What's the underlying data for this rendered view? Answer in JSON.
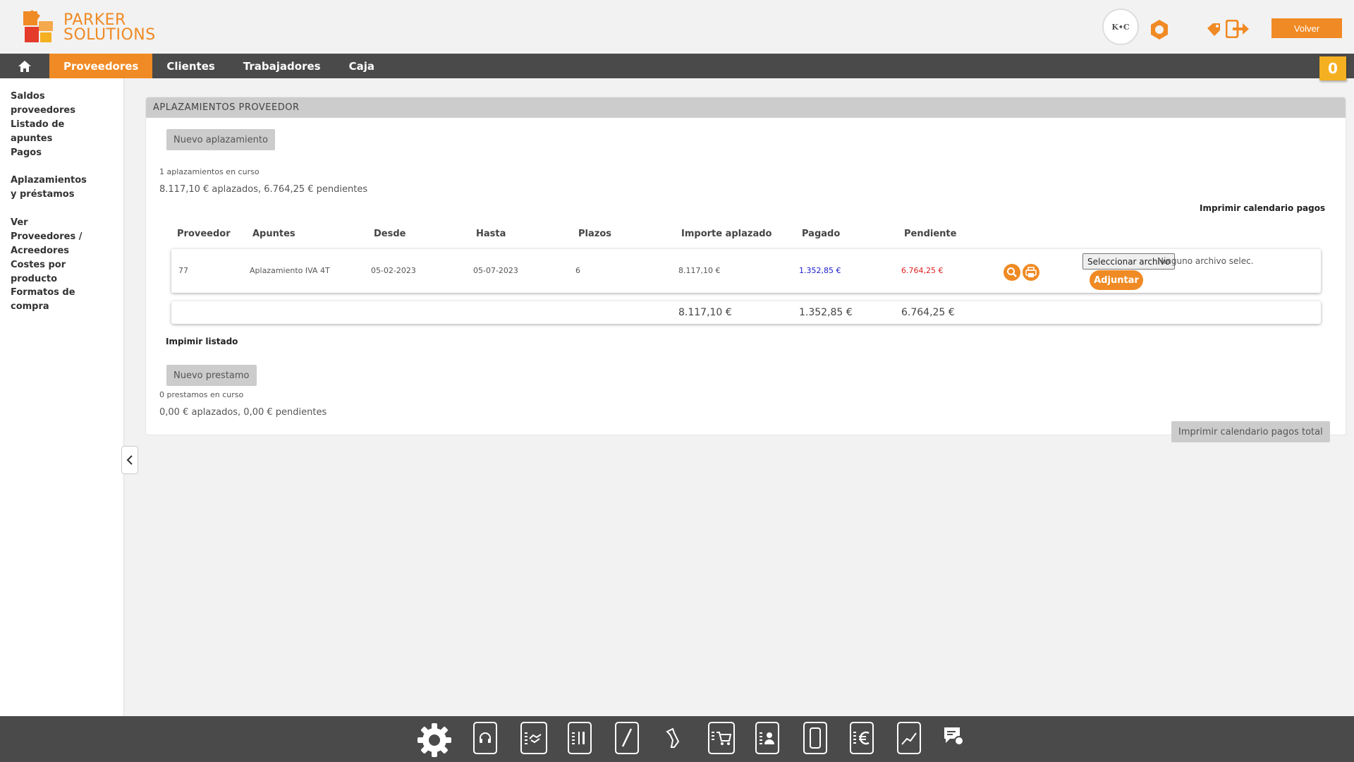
{
  "brand": {
    "name_line1": "PARKER",
    "name_line2": "SOLUTIONS",
    "accent_color": "#f08a24",
    "dark_color": "#4a4a4a"
  },
  "header": {
    "avatar_text": "K•C",
    "icons": [
      "hexagon-icon",
      "tag-icon",
      "logout-icon"
    ],
    "volver_label": "Volver",
    "cart_count": "0"
  },
  "nav": {
    "home_icon": "home-icon",
    "items": [
      {
        "label": "Proveedores",
        "active": true
      },
      {
        "label": "Clientes",
        "active": false
      },
      {
        "label": "Trabajadores",
        "active": false
      },
      {
        "label": "Caja",
        "active": false
      }
    ]
  },
  "sidebar": {
    "items": [
      {
        "label": "Saldos proveedores"
      },
      {
        "label": "Listado de apuntes"
      },
      {
        "label": "Pagos"
      },
      {
        "label": "Aplazamientos y préstamos"
      },
      {
        "label": "Ver Proveedores / Acreedores"
      },
      {
        "label": "Costes por producto"
      },
      {
        "label": "Formatos de compra"
      }
    ]
  },
  "panel": {
    "title": "APLAZAMIENTOS PROVEEDOR",
    "new_deferral_label": "Nuevo aplazamiento",
    "deferrals_count_text": "1 aplazamientos en curso",
    "deferrals_summary": "8.117,10 € aplazados, 6.764,25 € pendientes",
    "print_calendar_label": "Imprimir calendario pagos",
    "table": {
      "headers": [
        "Proveedor",
        "Apuntes",
        "Desde",
        "Hasta",
        "Plazos",
        "Importe aplazado",
        "Pagado",
        "Pendiente"
      ],
      "rows": [
        {
          "proveedor": "77",
          "apuntes": "Aplazamiento IVA 4T",
          "desde": "05-02-2023",
          "hasta": "05-07-2023",
          "plazos": "6",
          "importe": "8.117,10 €",
          "pagado": "1.352,85 €",
          "pendiente": "6.764,25 €",
          "file_button_label": "Seleccionar archivo",
          "file_status": "Ninguno archivo selec.",
          "attach_label": "Adjuntar"
        }
      ],
      "totals": {
        "importe": "8.117,10 €",
        "pagado": "1.352,85 €",
        "pendiente": "6.764,25 €"
      },
      "paid_color": "#1a1acc",
      "pending_color": "#e02020"
    },
    "print_list_label": "Impimir listado",
    "new_loan_label": "Nuevo prestamo",
    "loans_count_text": "0 prestamos en curso",
    "loans_summary": "0,00 € aplazados, 0,00 € pendientes",
    "print_total_label": "Imprimir calendario pagos total"
  },
  "dock": {
    "icons": [
      "gear-icon",
      "headset-icon",
      "handshake-icon",
      "cutlery-icon",
      "pen-icon",
      "spray-icon",
      "cart-icon",
      "contacts-icon",
      "mobile-icon",
      "euro-icon",
      "chart-icon",
      "chat-user-icon"
    ]
  }
}
